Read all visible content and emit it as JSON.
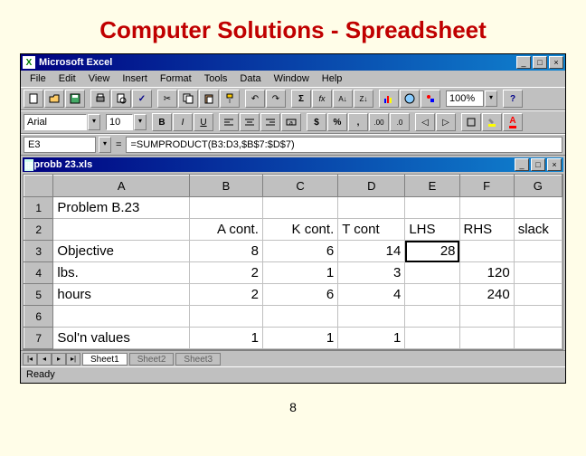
{
  "slide": {
    "title": "Computer Solutions - Spreadsheet",
    "page_number": "8"
  },
  "app": {
    "name": "Microsoft Excel",
    "workbook": "probb 23.xls"
  },
  "menu": [
    "File",
    "Edit",
    "View",
    "Insert",
    "Format",
    "Tools",
    "Data",
    "Window",
    "Help"
  ],
  "format_toolbar": {
    "font": "Arial",
    "size": "10",
    "zoom": "100%"
  },
  "formula_bar": {
    "cell_ref": "E3",
    "formula": "=SUMPRODUCT(B3:D3,$B$7:$D$7)"
  },
  "sheet": {
    "columns": [
      "A",
      "B",
      "C",
      "D",
      "E",
      "F",
      "G"
    ],
    "rows": [
      "1",
      "2",
      "3",
      "4",
      "5",
      "6",
      "7"
    ],
    "active_cell": "E3",
    "data": {
      "A1": "Problem B.23",
      "B2": "A cont.",
      "C2": "K cont.",
      "D2": "T cont",
      "E2": "LHS",
      "F2": "RHS",
      "G2": "slack",
      "A3": "Objective",
      "B3": "8",
      "C3": "6",
      "D3": "14",
      "E3": "28",
      "A4": "lbs.",
      "B4": "2",
      "C4": "1",
      "D4": "3",
      "F4": "120",
      "A5": "hours",
      "B5": "2",
      "C5": "6",
      "D5": "4",
      "F5": "240",
      "A7": "Sol'n values",
      "B7": "1",
      "C7": "1",
      "D7": "1"
    }
  },
  "tabs": {
    "active": "Sheet1",
    "others": [
      "Sheet2",
      "Sheet3"
    ]
  },
  "status": "Ready"
}
